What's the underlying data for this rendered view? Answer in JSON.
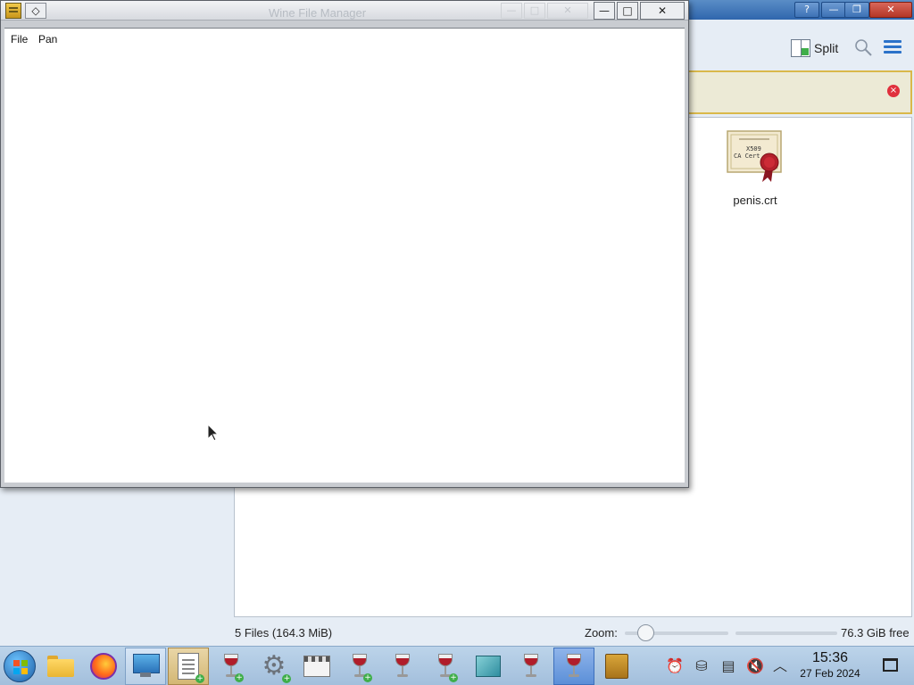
{
  "dolphin": {
    "titlebar_buttons": {
      "help": "?",
      "minimize": "—",
      "maximize": "❐",
      "close": "✕"
    },
    "toolbar": {
      "split_label": "Split",
      "search_icon": "search-icon",
      "menu_icon": "hamburger-icon"
    },
    "banner_close": "×",
    "file_item": {
      "name": "penis.crt",
      "icon": "certificate-icon",
      "cert_lines": [
        "X509",
        "CA Cert"
      ]
    },
    "status": {
      "files": "5 Files (164.3 MiB)",
      "zoom_label": "Zoom:",
      "zoom_level": 0.2,
      "free_space": "76.3 GiB free"
    }
  },
  "wine": {
    "title": "Wine File Manager",
    "sysmenu_glyph": "◇",
    "buttons": {
      "minimize": "—",
      "maximize": "□",
      "close": "✕",
      "ghost_minimize": "—",
      "ghost_maximize": "□",
      "ghost_close": "✕"
    },
    "menu": {
      "file": "File",
      "pan": "Pan"
    }
  },
  "taskbar": {
    "items": [
      {
        "icon": "folder-icon",
        "state": "normal"
      },
      {
        "icon": "firefox-icon",
        "state": "normal"
      },
      {
        "icon": "system-info-icon",
        "state": "active"
      },
      {
        "icon": "wine-notepad-icon",
        "state": "highlighted"
      },
      {
        "icon": "wine-glass-icon",
        "state": "normal"
      },
      {
        "icon": "wine-settings-icon",
        "state": "normal"
      },
      {
        "icon": "wine-store-icon",
        "state": "normal"
      },
      {
        "icon": "wine-glass-icon",
        "state": "normal"
      },
      {
        "icon": "wine-glass-icon",
        "state": "normal"
      },
      {
        "icon": "wine-glass-icon",
        "state": "normal"
      },
      {
        "icon": "wine-package-icon",
        "state": "normal"
      },
      {
        "icon": "wine-glass-icon",
        "state": "normal"
      },
      {
        "icon": "wine-glass-icon",
        "state": "selected"
      },
      {
        "icon": "wine-filemanager-icon",
        "state": "normal"
      }
    ],
    "tray": {
      "alarm": "⏰",
      "usb": "⛁",
      "clipboard": "▤",
      "volume": "🔇",
      "expand": "︿"
    },
    "clock": {
      "time": "15:36",
      "date": "27 Feb 2024"
    }
  },
  "colors": {
    "titlebar_blue": "#2f66ad",
    "banner_border": "#d9b84a",
    "close_red": "#e0303d",
    "accent_blue": "#2b72c9"
  }
}
